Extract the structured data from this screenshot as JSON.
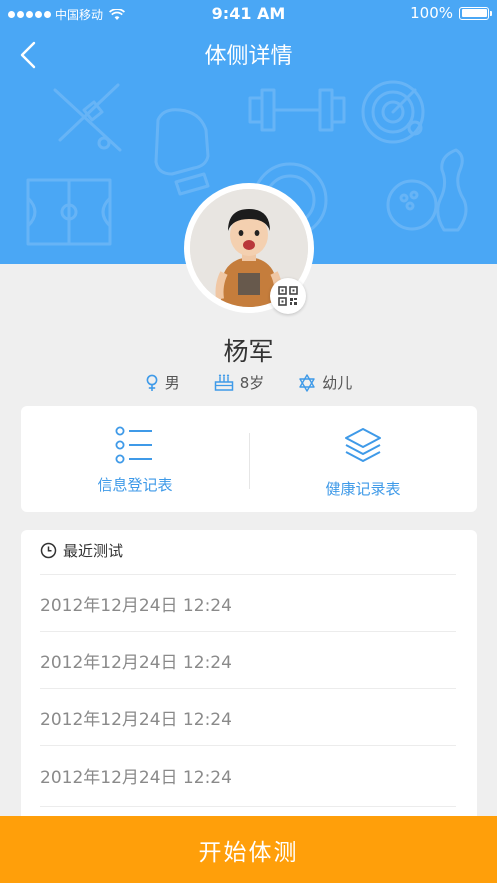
{
  "status_bar": {
    "carrier": "中国移动",
    "time": "9:41 AM",
    "battery": "100%",
    "battery_level": 1.0,
    "signal_icon": "signal-dots-icon",
    "wifi_icon": "wifi-icon"
  },
  "nav": {
    "title": "体侧详情",
    "back_icon": "chevron-left-icon"
  },
  "profile": {
    "name": "杨军",
    "gender": "男",
    "age": "8岁",
    "stage": "幼儿",
    "gender_icon": "female-symbol-icon",
    "age_icon": "birthday-cake-icon",
    "stage_icon": "star-of-david-icon",
    "qr_icon": "qr-code-icon"
  },
  "actions": [
    {
      "label": "信息登记表",
      "icon": "list-icon"
    },
    {
      "label": "健康记录表",
      "icon": "layers-icon"
    }
  ],
  "recent": {
    "title": "最近测试",
    "icon": "clock-icon",
    "items": [
      "2012年12月24日 12:24",
      "2012年12月24日 12:24",
      "2012年12月24日 12:24",
      "2012年12月24日 12:24"
    ]
  },
  "start_button": "开始体测",
  "colors": {
    "header_blue": "#4aa7f5",
    "accent_blue": "#3f9ae8",
    "orange": "#ff9f0a",
    "background": "#efefef"
  }
}
